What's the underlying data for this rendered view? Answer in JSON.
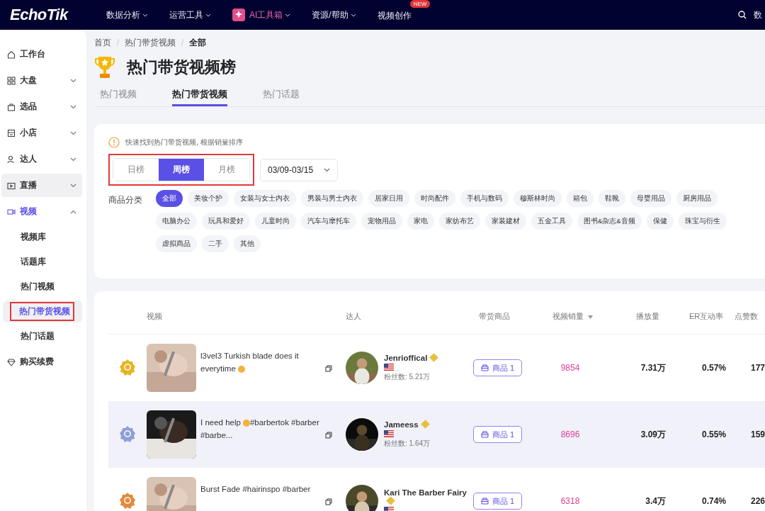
{
  "topnav": {
    "logo": "EchoTik",
    "items": [
      {
        "label": "数据分析",
        "kind": "menu"
      },
      {
        "label": "运营工具",
        "kind": "menu"
      },
      {
        "label": "AI工具箱",
        "kind": "ai"
      },
      {
        "label": "资源/帮助",
        "kind": "menu"
      },
      {
        "label": "视频创作",
        "kind": "new",
        "badge": "NEW"
      }
    ],
    "right_text": "数"
  },
  "sidebar": {
    "items": [
      {
        "label": "工作台",
        "expandable": false,
        "expanded": false,
        "hovered": false
      },
      {
        "label": "大盘",
        "expandable": true,
        "expanded": false,
        "hovered": false
      },
      {
        "label": "选品",
        "expandable": true,
        "expanded": false,
        "hovered": false
      },
      {
        "label": "小店",
        "expandable": true,
        "expanded": false,
        "hovered": false
      },
      {
        "label": "达人",
        "expandable": true,
        "expanded": false,
        "hovered": false
      },
      {
        "label": "直播",
        "expandable": true,
        "expanded": false,
        "hovered": true
      },
      {
        "label": "视频",
        "expandable": true,
        "expanded": true,
        "hovered": false,
        "children": [
          {
            "label": "视频库",
            "selected": false,
            "highlighted": false
          },
          {
            "label": "话题库",
            "selected": false,
            "highlighted": false
          },
          {
            "label": "热门视频",
            "selected": false,
            "highlighted": false
          },
          {
            "label": "热门带货视频",
            "selected": true,
            "highlighted": true
          },
          {
            "label": "热门话题",
            "selected": false,
            "highlighted": false
          }
        ]
      },
      {
        "label": "购买续费",
        "expandable": false,
        "expanded": false,
        "hovered": false
      }
    ]
  },
  "breadcrumb": [
    "首页",
    "热门带货视频",
    "全部"
  ],
  "page_title": "热门带货视频榜",
  "tabs": [
    {
      "label": "热门视频",
      "selected": false
    },
    {
      "label": "热门带货视频",
      "selected": true
    },
    {
      "label": "热门话题",
      "selected": false
    }
  ],
  "filters": {
    "hint": "快速找到热门带货视频, 根据销量排序",
    "periods": [
      {
        "label": "日榜",
        "selected": false
      },
      {
        "label": "周榜",
        "selected": true
      },
      {
        "label": "月榜",
        "selected": false
      }
    ],
    "periods_highlighted": true,
    "date": "03/09-03/15",
    "category_label": "商品分类",
    "categories": [
      [
        {
          "label": "全部",
          "selected": true
        },
        {
          "label": "美妆个护",
          "selected": false
        },
        {
          "label": "女装与女士内衣",
          "selected": false
        },
        {
          "label": "男装与男士内衣",
          "selected": false
        },
        {
          "label": "居家日用",
          "selected": false
        },
        {
          "label": "时尚配件",
          "selected": false
        },
        {
          "label": "手机与数码",
          "selected": false
        },
        {
          "label": "穆斯林时尚",
          "selected": false
        },
        {
          "label": "箱包",
          "selected": false
        },
        {
          "label": "鞋靴",
          "selected": false
        },
        {
          "label": "母婴用品",
          "selected": false
        },
        {
          "label": "厨房用品",
          "selected": false
        }
      ],
      [
        {
          "label": "电脑办公",
          "selected": false
        },
        {
          "label": "玩具和爱好",
          "selected": false
        },
        {
          "label": "儿童时尚",
          "selected": false
        },
        {
          "label": "汽车与摩托车",
          "selected": false
        },
        {
          "label": "宠物用品",
          "selected": false
        },
        {
          "label": "家电",
          "selected": false
        },
        {
          "label": "家纺布艺",
          "selected": false
        },
        {
          "label": "家装建材",
          "selected": false
        },
        {
          "label": "五金工具",
          "selected": false
        },
        {
          "label": "图书&杂志&音频",
          "selected": false
        },
        {
          "label": "保健",
          "selected": false
        },
        {
          "label": "珠宝与衍生",
          "selected": false
        }
      ],
      [
        {
          "label": "虚拟商品",
          "selected": false
        },
        {
          "label": "二手",
          "selected": false
        },
        {
          "label": "其他",
          "selected": false
        }
      ]
    ]
  },
  "table": {
    "columns": [
      "视频",
      "达人",
      "带货商品",
      "视频销量",
      "播放量",
      "ER互动率",
      "点赞数"
    ],
    "rows": [
      {
        "color": "#e6b422",
        "title": [
          "l3vel3 Turkish blade does it everytime"
        ],
        "emoji": true,
        "creator": "Jenrioffical",
        "followers": "粉丝数: 5.21万",
        "goods": "商品 1",
        "sales": "9854",
        "plays": "7.31万",
        "er": "0.57%",
        "likes": "177",
        "striped": false
      },
      {
        "color": "#8e9fd6",
        "title": [
          "I need help",
          "#barbertok #barber #barbe..."
        ],
        "emoji": true,
        "creator": "Jameess",
        "followers": "粉丝数: 1.64万",
        "goods": "商品 1",
        "sales": "8696",
        "plays": "3.09万",
        "er": "0.55%",
        "likes": "159",
        "striped": true
      },
      {
        "color": "#e08a3c",
        "title": [
          "Burst Fade #hairinspo #barber"
        ],
        "emoji": false,
        "creator": "Kari The Barber Fairy",
        "goods": "商品 1",
        "sales": "6318",
        "plays": "3.4万",
        "er": "0.74%",
        "likes": "226",
        "striped": false
      }
    ]
  }
}
